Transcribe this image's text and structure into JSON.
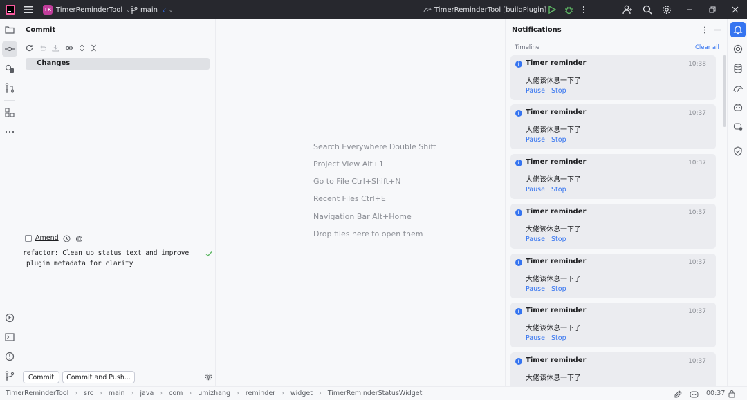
{
  "titlebar": {
    "project_badge": "TR",
    "project_name": "TimerReminderTool",
    "branch": "main",
    "run_config": "TimerReminderTool [buildPlugin]"
  },
  "commit_panel": {
    "title": "Commit",
    "changes_label": "Changes",
    "amend_label": "Amend",
    "message_line1": "refactor: Clean up status text and improve",
    "message_line2": "plugin metadata for clarity",
    "commit_button": "Commit",
    "commit_push_button": "Commit and Push..."
  },
  "editor": {
    "hints": [
      "Search Everywhere Double Shift",
      "Project View Alt+1",
      "Go to File Ctrl+Shift+N",
      "Recent Files Ctrl+E",
      "Navigation Bar Alt+Home",
      "Drop files here to open them"
    ]
  },
  "notifications": {
    "title": "Notifications",
    "timeline_label": "Timeline",
    "clear_all": "Clear all",
    "items": [
      {
        "title": "Timer reminder",
        "time": "10:38",
        "message": "大佬该休息一下了",
        "pause": "Pause",
        "stop": "Stop"
      },
      {
        "title": "Timer reminder",
        "time": "10:37",
        "message": "大佬该休息一下了",
        "pause": "Pause",
        "stop": "Stop"
      },
      {
        "title": "Timer reminder",
        "time": "10:37",
        "message": "大佬该休息一下了",
        "pause": "Pause",
        "stop": "Stop"
      },
      {
        "title": "Timer reminder",
        "time": "10:37",
        "message": "大佬该休息一下了",
        "pause": "Pause",
        "stop": "Stop"
      },
      {
        "title": "Timer reminder",
        "time": "10:37",
        "message": "大佬该休息一下了",
        "pause": "Pause",
        "stop": "Stop"
      },
      {
        "title": "Timer reminder",
        "time": "10:37",
        "message": "大佬该休息一下了",
        "pause": "Pause",
        "stop": "Stop"
      },
      {
        "title": "Timer reminder",
        "time": "10:37",
        "message": "大佬该休息一下了",
        "pause": "",
        "stop": ""
      }
    ]
  },
  "statusbar": {
    "breadcrumbs": [
      "TimerReminderTool",
      "src",
      "main",
      "java",
      "com",
      "umizhang",
      "reminder",
      "widget",
      "TimerReminderStatusWidget"
    ],
    "clock": "00:37"
  },
  "colors": {
    "titlebar_bg": "#27282e",
    "accent": "#3574f0",
    "project_badge": "#c13d9b",
    "run_green": "#5fb865"
  }
}
